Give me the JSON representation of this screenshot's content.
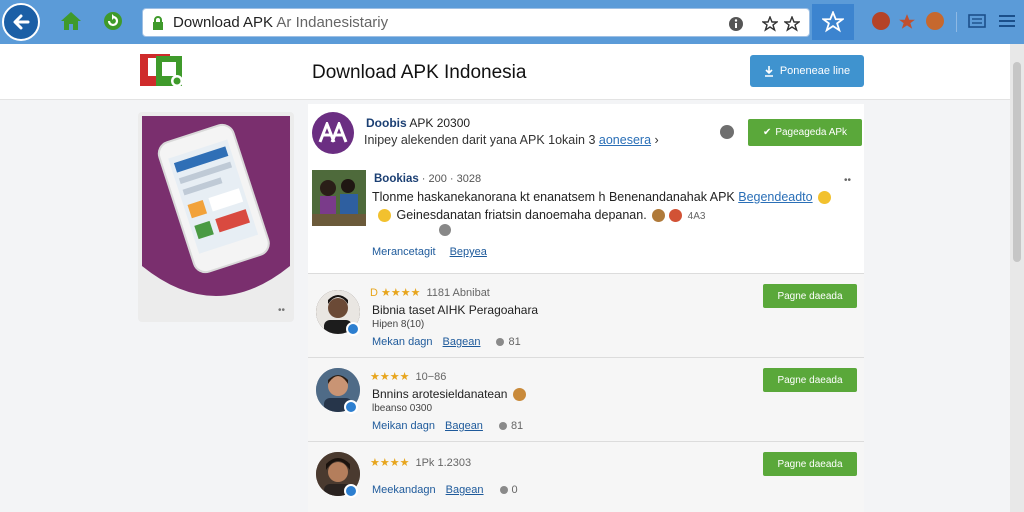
{
  "browser": {
    "url_main": "Download APK",
    "url_rest": " Ar Indanesistariy",
    "colors": {
      "toolbar": "#5b9bd8",
      "star_box": "#3c84cf"
    }
  },
  "header": {
    "site_title": "Download APK Indonesia",
    "button_label": "Poneneae line"
  },
  "app": {
    "name_bold": "Doobis",
    "name_rest": " APK 20300",
    "desc": "Inipey alekenden darit yana APK 1okain 3 ",
    "desc_link": "aonesera",
    "download_label": "Pageageda APk"
  },
  "post": {
    "author": "Bookias",
    "meta": " · 200 · 3028",
    "text1": "Tlonme haskanekanorana kt enanatsem h Benenandanahak APK ",
    "text1_link": "Begendeadto",
    "text2": "Geinesdanatan friatsin danoemaha depanan.",
    "count": "4A3",
    "link1": "Merancetagit",
    "link2": "Bepyea"
  },
  "reviews": [
    {
      "stars": "D ★★★★",
      "meta": "1181 Abnibat",
      "text": "Bibnia taset AIHK Peragoahara",
      "sub": "Hipen 8(10)",
      "link1": "Mekan dagn",
      "link2": "Bagean",
      "count": "81",
      "button": "Pagne daeada"
    },
    {
      "stars": "★★★★",
      "meta": "10−86",
      "text": "Bnnins arotesieldanatean",
      "sub": "lbeanso 0300",
      "link1": "Meikan dagn",
      "link2": "Bagean",
      "count": "81",
      "button": "Pagne daeada"
    },
    {
      "stars": "★★★★",
      "meta": "1Pk  1.2303",
      "text": "",
      "sub": "",
      "link1": "Meekandagn",
      "link2": "Bagean",
      "count": "0",
      "button": "Pagne daeada"
    }
  ],
  "icons": [
    "back-arrow-icon",
    "home-icon",
    "refresh-icon",
    "lock-icon",
    "info-icon",
    "star-icon",
    "bookmark-star-icon",
    "shield-icon",
    "pin-icon",
    "shop-icon",
    "library-icon",
    "menu-icon"
  ]
}
